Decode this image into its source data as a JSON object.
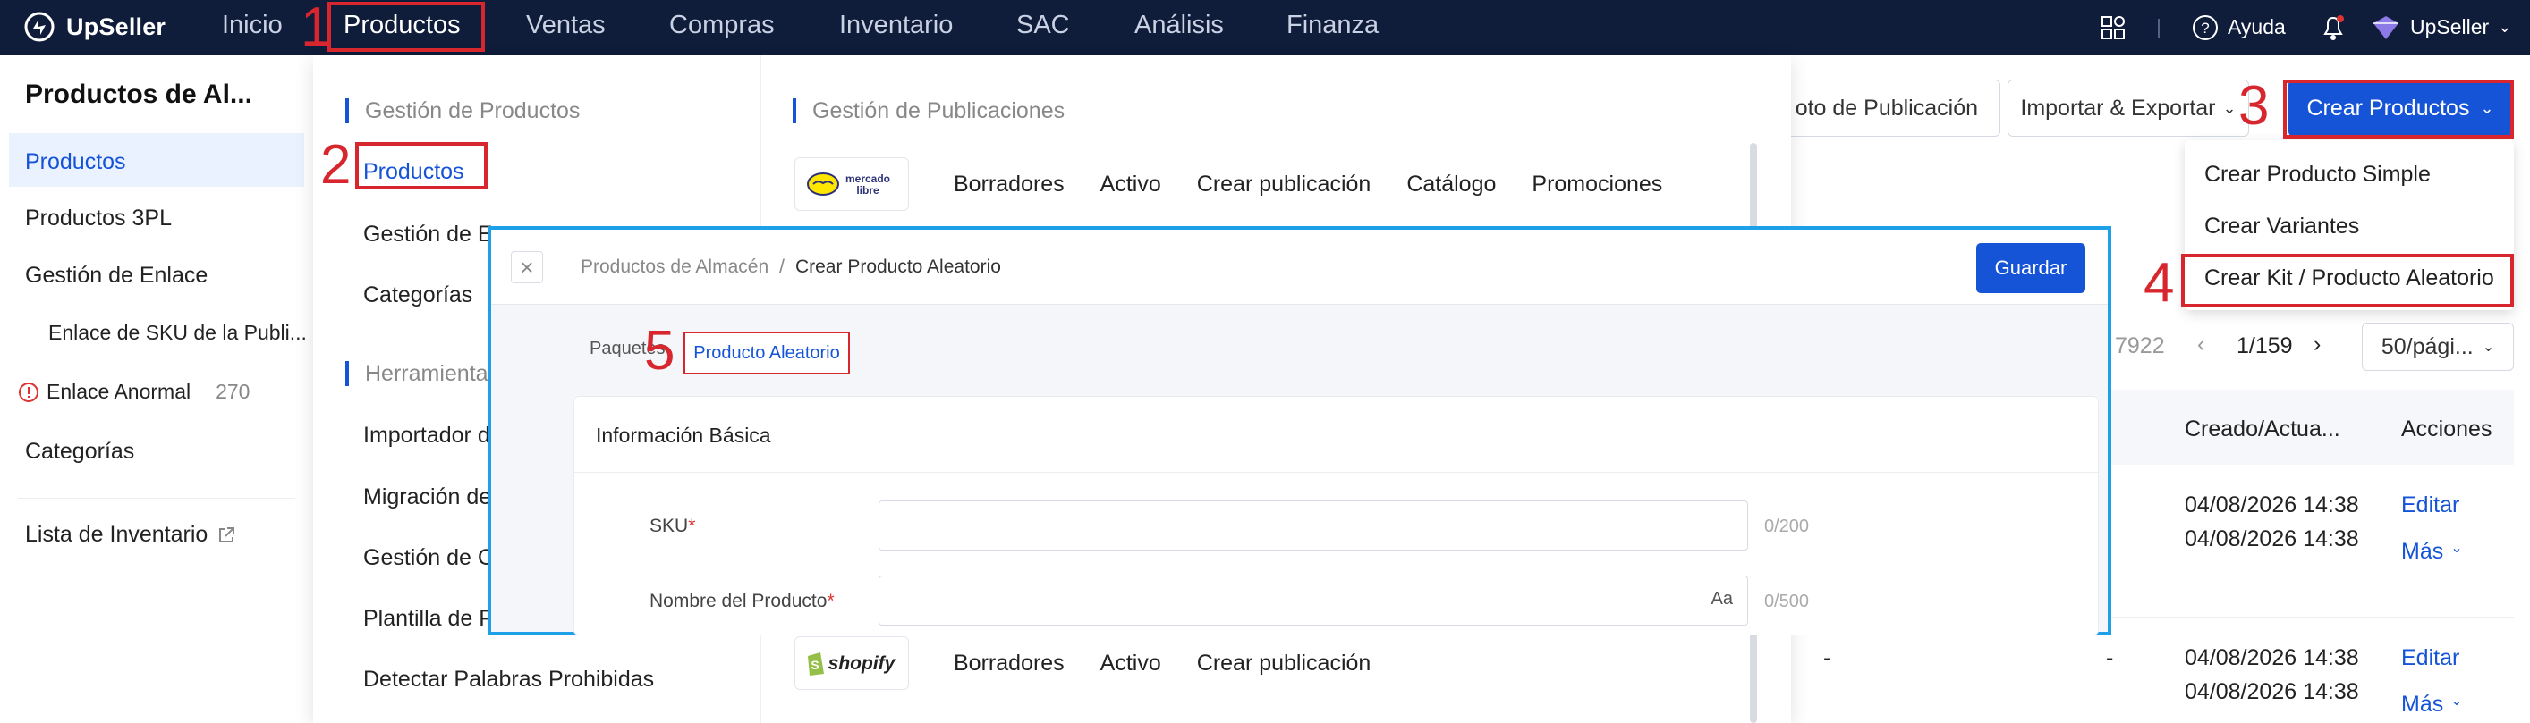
{
  "topbar": {
    "logo": "UpSeller",
    "nav": [
      "Inicio",
      "Productos",
      "Ventas",
      "Compras",
      "Inventario",
      "SAC",
      "Análisis",
      "Finanza"
    ],
    "help": "Ayuda",
    "user": "UpSeller"
  },
  "sidebar": {
    "title": "Productos de Al...",
    "items": [
      {
        "label": "Productos"
      },
      {
        "label": "Productos 3PL"
      },
      {
        "label": "Gestión de Enlace"
      },
      {
        "label": "Enlace de SKU de la Publi..."
      },
      {
        "label": "Enlace Anormal"
      },
      {
        "label": "Categorías"
      },
      {
        "label": "Lista de Inventario"
      }
    ],
    "anormal_count": "270"
  },
  "toolbar": {
    "publicacion_btn": "oto de Publicación",
    "import_export": "Importar & Exportar",
    "create_btn": "Crear Productos"
  },
  "create_menu": {
    "items": [
      "Crear Producto Simple",
      "Crear Variantes",
      "Crear Kit / Producto Aleatorio"
    ]
  },
  "pagination": {
    "total": "7922",
    "page": "1/159",
    "per_page": "50/pági..."
  },
  "table": {
    "col_created": "Creado/Actua...",
    "col_actions": "Acciones",
    "rows": [
      {
        "created": "04/08/2026 14:38",
        "updated": "04/08/2026 14:38",
        "edit": "Editar",
        "more": "Más"
      },
      {
        "created": "04/08/2026 14:38",
        "updated": "04/08/2026 14:38",
        "edit": "Editar",
        "more": "Más"
      }
    ],
    "dash": "-"
  },
  "mega_menu": {
    "left_head": "Gestión de Productos",
    "left_links": [
      "Productos",
      "Gestión de E",
      "Categorías"
    ],
    "tools_head": "Herramientas",
    "tools_links": [
      "Importador d",
      "Migración de",
      "Gestión de C",
      "Plantilla de P",
      "Detectar Palabras Prohibidas"
    ],
    "right_head": "Gestión de Publicaciones",
    "mercadolibre": {
      "logo": "mercado libre",
      "links": [
        "Borradores",
        "Activo",
        "Crear publicación",
        "Catálogo",
        "Promociones"
      ]
    },
    "shopify": {
      "logo": "shopify",
      "links": [
        "Borradores",
        "Activo",
        "Crear publicación"
      ]
    }
  },
  "modal": {
    "crumb_parent": "Productos de Almacén",
    "crumb_sep": "/",
    "crumb_current": "Crear Producto Aleatorio",
    "save": "Guardar",
    "tab1": "Paquetes",
    "tab2": "Producto Aleatorio",
    "section_title": "Información Básica",
    "sku_label": "SKU",
    "sku_count": "0/200",
    "name_label": "Nombre del Producto",
    "name_count": "0/500",
    "aa": "Aa",
    "required_mark": "*"
  },
  "annotations": [
    "1",
    "2",
    "3",
    "4",
    "5"
  ],
  "colors": {
    "primary": "#1554d6",
    "nav_bg": "#0f1c3a",
    "annotation_red": "#d7262e",
    "modal_border": "#1ea0e8"
  }
}
